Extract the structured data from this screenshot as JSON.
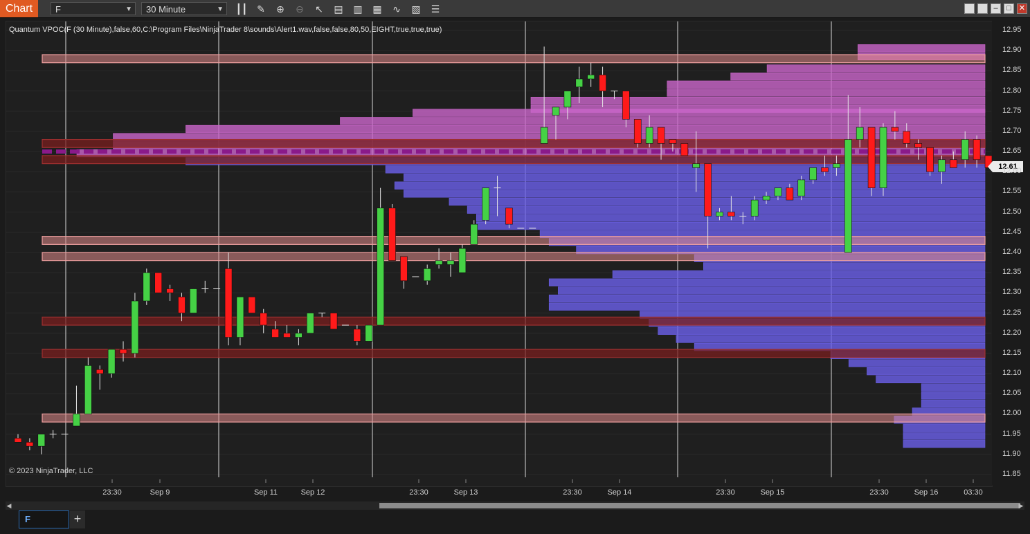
{
  "window": {
    "tag": "Chart",
    "instrument": "F",
    "interval": "30 Minute"
  },
  "toolbar": {
    "icons": [
      "bar-type-icon",
      "draw-icon",
      "zoom-in-icon",
      "zoom-out-icon",
      "pointer-icon",
      "data-box-icon",
      "properties-icon",
      "strategies-icon",
      "indicators-icon",
      "templates-icon",
      "list-icon"
    ]
  },
  "indicator_label": "Quantum VPOC(F (30 Minute),false,60,C:\\Program Files\\NinjaTrader 8\\sounds\\Alert1.wav,false,false,80,50,EIGHT,true,true,true)",
  "copyright": "© 2023 NinjaTrader, LLC",
  "last_price": "12.61",
  "tab_label": "F",
  "colors": {
    "up": "#45d145",
    "down": "#ff1a1a",
    "profile_blue": "#6a5fe6",
    "profile_pink": "#c865c8",
    "level_light": "#e08a8a",
    "level_dark": "#7a1f1f",
    "vpoc": "#8a1a8a"
  },
  "chart_data": {
    "type": "candlestick",
    "ylim": [
      11.85,
      12.95
    ],
    "y_ticks": [
      "12.95",
      "12.90",
      "12.85",
      "12.80",
      "12.75",
      "12.70",
      "12.65",
      "12.60",
      "12.55",
      "12.50",
      "12.45",
      "12.40",
      "12.35",
      "12.30",
      "12.25",
      "12.20",
      "12.15",
      "12.10",
      "12.05",
      "12.00",
      "11.95",
      "11.90",
      "11.85"
    ],
    "x_labels": [
      "23:30",
      "Sep 9",
      "Sep 11",
      "Sep 12",
      "23:30",
      "Sep 13",
      "23:30",
      "Sep 14",
      "23:30",
      "Sep 15",
      "23:30",
      "Sep 16",
      "03:30"
    ],
    "ohlc": [
      [
        11.94,
        11.95,
        11.93,
        11.93
      ],
      [
        11.93,
        11.94,
        11.91,
        11.92
      ],
      [
        11.92,
        11.94,
        11.9,
        11.95
      ],
      [
        11.95,
        11.96,
        11.94,
        11.95
      ],
      [
        11.95,
        11.95,
        11.95,
        11.95
      ],
      [
        11.97,
        12.07,
        11.97,
        12.0
      ],
      [
        12.0,
        12.14,
        12.0,
        12.12
      ],
      [
        12.11,
        12.12,
        12.06,
        12.1
      ],
      [
        12.1,
        12.14,
        12.09,
        12.16
      ],
      [
        12.16,
        12.18,
        12.13,
        12.15
      ],
      [
        12.15,
        12.3,
        12.14,
        12.28
      ],
      [
        12.28,
        12.36,
        12.27,
        12.35
      ],
      [
        12.35,
        12.35,
        12.3,
        12.3
      ],
      [
        12.31,
        12.32,
        12.28,
        12.3
      ],
      [
        12.29,
        12.3,
        12.23,
        12.25
      ],
      [
        12.25,
        12.31,
        12.25,
        12.31
      ],
      [
        12.31,
        12.33,
        12.3,
        12.31
      ],
      [
        12.31,
        12.31,
        12.31,
        12.31
      ],
      [
        12.36,
        12.4,
        12.17,
        12.19
      ],
      [
        12.19,
        12.29,
        12.17,
        12.29
      ],
      [
        12.29,
        12.29,
        12.25,
        12.25
      ],
      [
        12.25,
        12.26,
        12.2,
        12.22
      ],
      [
        12.21,
        12.23,
        12.19,
        12.19
      ],
      [
        12.2,
        12.22,
        12.19,
        12.19
      ],
      [
        12.19,
        12.21,
        12.17,
        12.2
      ],
      [
        12.2,
        12.25,
        12.2,
        12.25
      ],
      [
        12.25,
        12.25,
        12.24,
        12.25
      ],
      [
        12.25,
        12.25,
        12.21,
        12.21
      ],
      [
        12.22,
        12.22,
        12.22,
        12.22
      ],
      [
        12.21,
        12.22,
        12.17,
        12.18
      ],
      [
        12.18,
        12.22,
        12.18,
        12.22
      ],
      [
        12.22,
        12.56,
        12.22,
        12.51
      ],
      [
        12.51,
        12.52,
        12.38,
        12.38
      ],
      [
        12.39,
        12.39,
        12.31,
        12.33
      ],
      [
        12.34,
        12.34,
        12.34,
        12.34
      ],
      [
        12.33,
        12.37,
        12.32,
        12.36
      ],
      [
        12.37,
        12.41,
        12.36,
        12.38
      ],
      [
        12.37,
        12.4,
        12.34,
        12.38
      ],
      [
        12.35,
        12.42,
        12.35,
        12.41
      ],
      [
        12.42,
        12.48,
        12.42,
        12.47
      ],
      [
        12.48,
        12.56,
        12.47,
        12.56
      ],
      [
        12.56,
        12.59,
        12.49,
        12.56
      ],
      [
        12.51,
        12.51,
        12.46,
        12.47
      ],
      [
        12.46,
        12.46,
        12.46,
        12.46
      ],
      [
        12.46,
        12.46,
        12.46,
        12.46
      ],
      [
        12.67,
        12.91,
        12.67,
        12.71
      ],
      [
        12.74,
        12.76,
        12.68,
        12.76
      ],
      [
        12.76,
        12.79,
        12.73,
        12.8
      ],
      [
        12.81,
        12.86,
        12.77,
        12.83
      ],
      [
        12.83,
        12.87,
        12.81,
        12.84
      ],
      [
        12.84,
        12.86,
        12.76,
        12.8
      ],
      [
        12.8,
        12.8,
        12.78,
        12.8
      ],
      [
        12.8,
        12.8,
        12.71,
        12.73
      ],
      [
        12.73,
        12.73,
        12.66,
        12.67
      ],
      [
        12.67,
        12.74,
        12.66,
        12.71
      ],
      [
        12.71,
        12.71,
        12.63,
        12.67
      ],
      [
        12.68,
        12.68,
        12.65,
        12.67
      ],
      [
        12.67,
        12.67,
        12.64,
        12.64
      ],
      [
        12.61,
        12.7,
        12.55,
        12.62
      ],
      [
        12.62,
        12.62,
        12.41,
        12.49
      ],
      [
        12.49,
        12.51,
        12.48,
        12.5
      ],
      [
        12.5,
        12.54,
        12.48,
        12.49
      ],
      [
        12.49,
        12.5,
        12.47,
        12.49
      ],
      [
        12.49,
        12.54,
        12.48,
        12.53
      ],
      [
        12.53,
        12.55,
        12.52,
        12.54
      ],
      [
        12.54,
        12.56,
        12.53,
        12.56
      ],
      [
        12.56,
        12.57,
        12.53,
        12.53
      ],
      [
        12.54,
        12.59,
        12.53,
        12.58
      ],
      [
        12.58,
        12.61,
        12.57,
        12.61
      ],
      [
        12.61,
        12.64,
        12.59,
        12.6
      ],
      [
        12.61,
        12.64,
        12.59,
        12.62
      ],
      [
        12.4,
        12.79,
        12.4,
        12.68
      ],
      [
        12.68,
        12.76,
        12.66,
        12.71
      ],
      [
        12.71,
        12.71,
        12.54,
        12.56
      ],
      [
        12.56,
        12.72,
        12.54,
        12.71
      ],
      [
        12.71,
        12.75,
        12.68,
        12.7
      ],
      [
        12.7,
        12.72,
        12.66,
        12.67
      ],
      [
        12.67,
        12.68,
        12.63,
        12.66
      ],
      [
        12.66,
        12.66,
        12.59,
        12.6
      ],
      [
        12.6,
        12.64,
        12.57,
        12.63
      ],
      [
        12.63,
        12.65,
        12.61,
        12.61
      ],
      [
        12.63,
        12.7,
        12.61,
        12.68
      ],
      [
        12.68,
        12.69,
        12.61,
        12.63
      ],
      [
        12.64,
        12.64,
        12.61,
        12.61
      ]
    ],
    "levels": [
      {
        "price": 12.88,
        "style": "light"
      },
      {
        "price": 12.67,
        "style": "dark"
      },
      {
        "price": 12.63,
        "style": "dark"
      },
      {
        "price": 12.43,
        "style": "light"
      },
      {
        "price": 12.39,
        "style": "light"
      },
      {
        "price": 12.23,
        "style": "dark"
      },
      {
        "price": 12.15,
        "style": "dark"
      },
      {
        "price": 11.99,
        "style": "light"
      }
    ],
    "vpoc_price": 12.65,
    "profile": [
      {
        "price": 12.905,
        "len": 0.14
      },
      {
        "price": 12.885,
        "len": 0.14
      },
      {
        "price": 12.855,
        "len": 0.24
      },
      {
        "price": 12.835,
        "len": 0.28
      },
      {
        "price": 12.815,
        "len": 0.35
      },
      {
        "price": 12.795,
        "len": 0.35
      },
      {
        "price": 12.775,
        "len": 0.5
      },
      {
        "price": 12.755,
        "len": 0.5
      },
      {
        "price": 12.745,
        "len": 0.63
      },
      {
        "price": 12.725,
        "len": 0.71
      },
      {
        "price": 12.705,
        "len": 0.88
      },
      {
        "price": 12.685,
        "len": 0.96
      },
      {
        "price": 12.665,
        "len": 0.96
      },
      {
        "price": 12.645,
        "len": 1.0
      },
      {
        "price": 12.625,
        "len": 0.88
      },
      {
        "price": 12.605,
        "len": 0.66
      },
      {
        "price": 12.585,
        "len": 0.64
      },
      {
        "price": 12.565,
        "len": 0.65
      },
      {
        "price": 12.545,
        "len": 0.64
      },
      {
        "price": 12.525,
        "len": 0.59
      },
      {
        "price": 12.505,
        "len": 0.57
      },
      {
        "price": 12.485,
        "len": 0.56
      },
      {
        "price": 12.465,
        "len": 0.56
      },
      {
        "price": 12.445,
        "len": 0.49
      },
      {
        "price": 12.425,
        "len": 0.48
      },
      {
        "price": 12.405,
        "len": 0.45
      },
      {
        "price": 12.385,
        "len": 0.32
      },
      {
        "price": 12.365,
        "len": 0.31
      },
      {
        "price": 12.345,
        "len": 0.41
      },
      {
        "price": 12.325,
        "len": 0.48
      },
      {
        "price": 12.305,
        "len": 0.47
      },
      {
        "price": 12.285,
        "len": 0.48
      },
      {
        "price": 12.265,
        "len": 0.48
      },
      {
        "price": 12.245,
        "len": 0.38
      },
      {
        "price": 12.225,
        "len": 0.37
      },
      {
        "price": 12.205,
        "len": 0.36
      },
      {
        "price": 12.185,
        "len": 0.34
      },
      {
        "price": 12.165,
        "len": 0.32
      },
      {
        "price": 12.145,
        "len": 0.17
      },
      {
        "price": 12.125,
        "len": 0.15
      },
      {
        "price": 12.105,
        "len": 0.13
      },
      {
        "price": 12.085,
        "len": 0.12
      },
      {
        "price": 12.065,
        "len": 0.07
      },
      {
        "price": 12.045,
        "len": 0.07
      },
      {
        "price": 12.025,
        "len": 0.07
      },
      {
        "price": 12.005,
        "len": 0.08
      },
      {
        "price": 11.985,
        "len": 0.1
      },
      {
        "price": 11.965,
        "len": 0.09
      },
      {
        "price": 11.945,
        "len": 0.09
      },
      {
        "price": 11.925,
        "len": 0.09
      }
    ]
  }
}
